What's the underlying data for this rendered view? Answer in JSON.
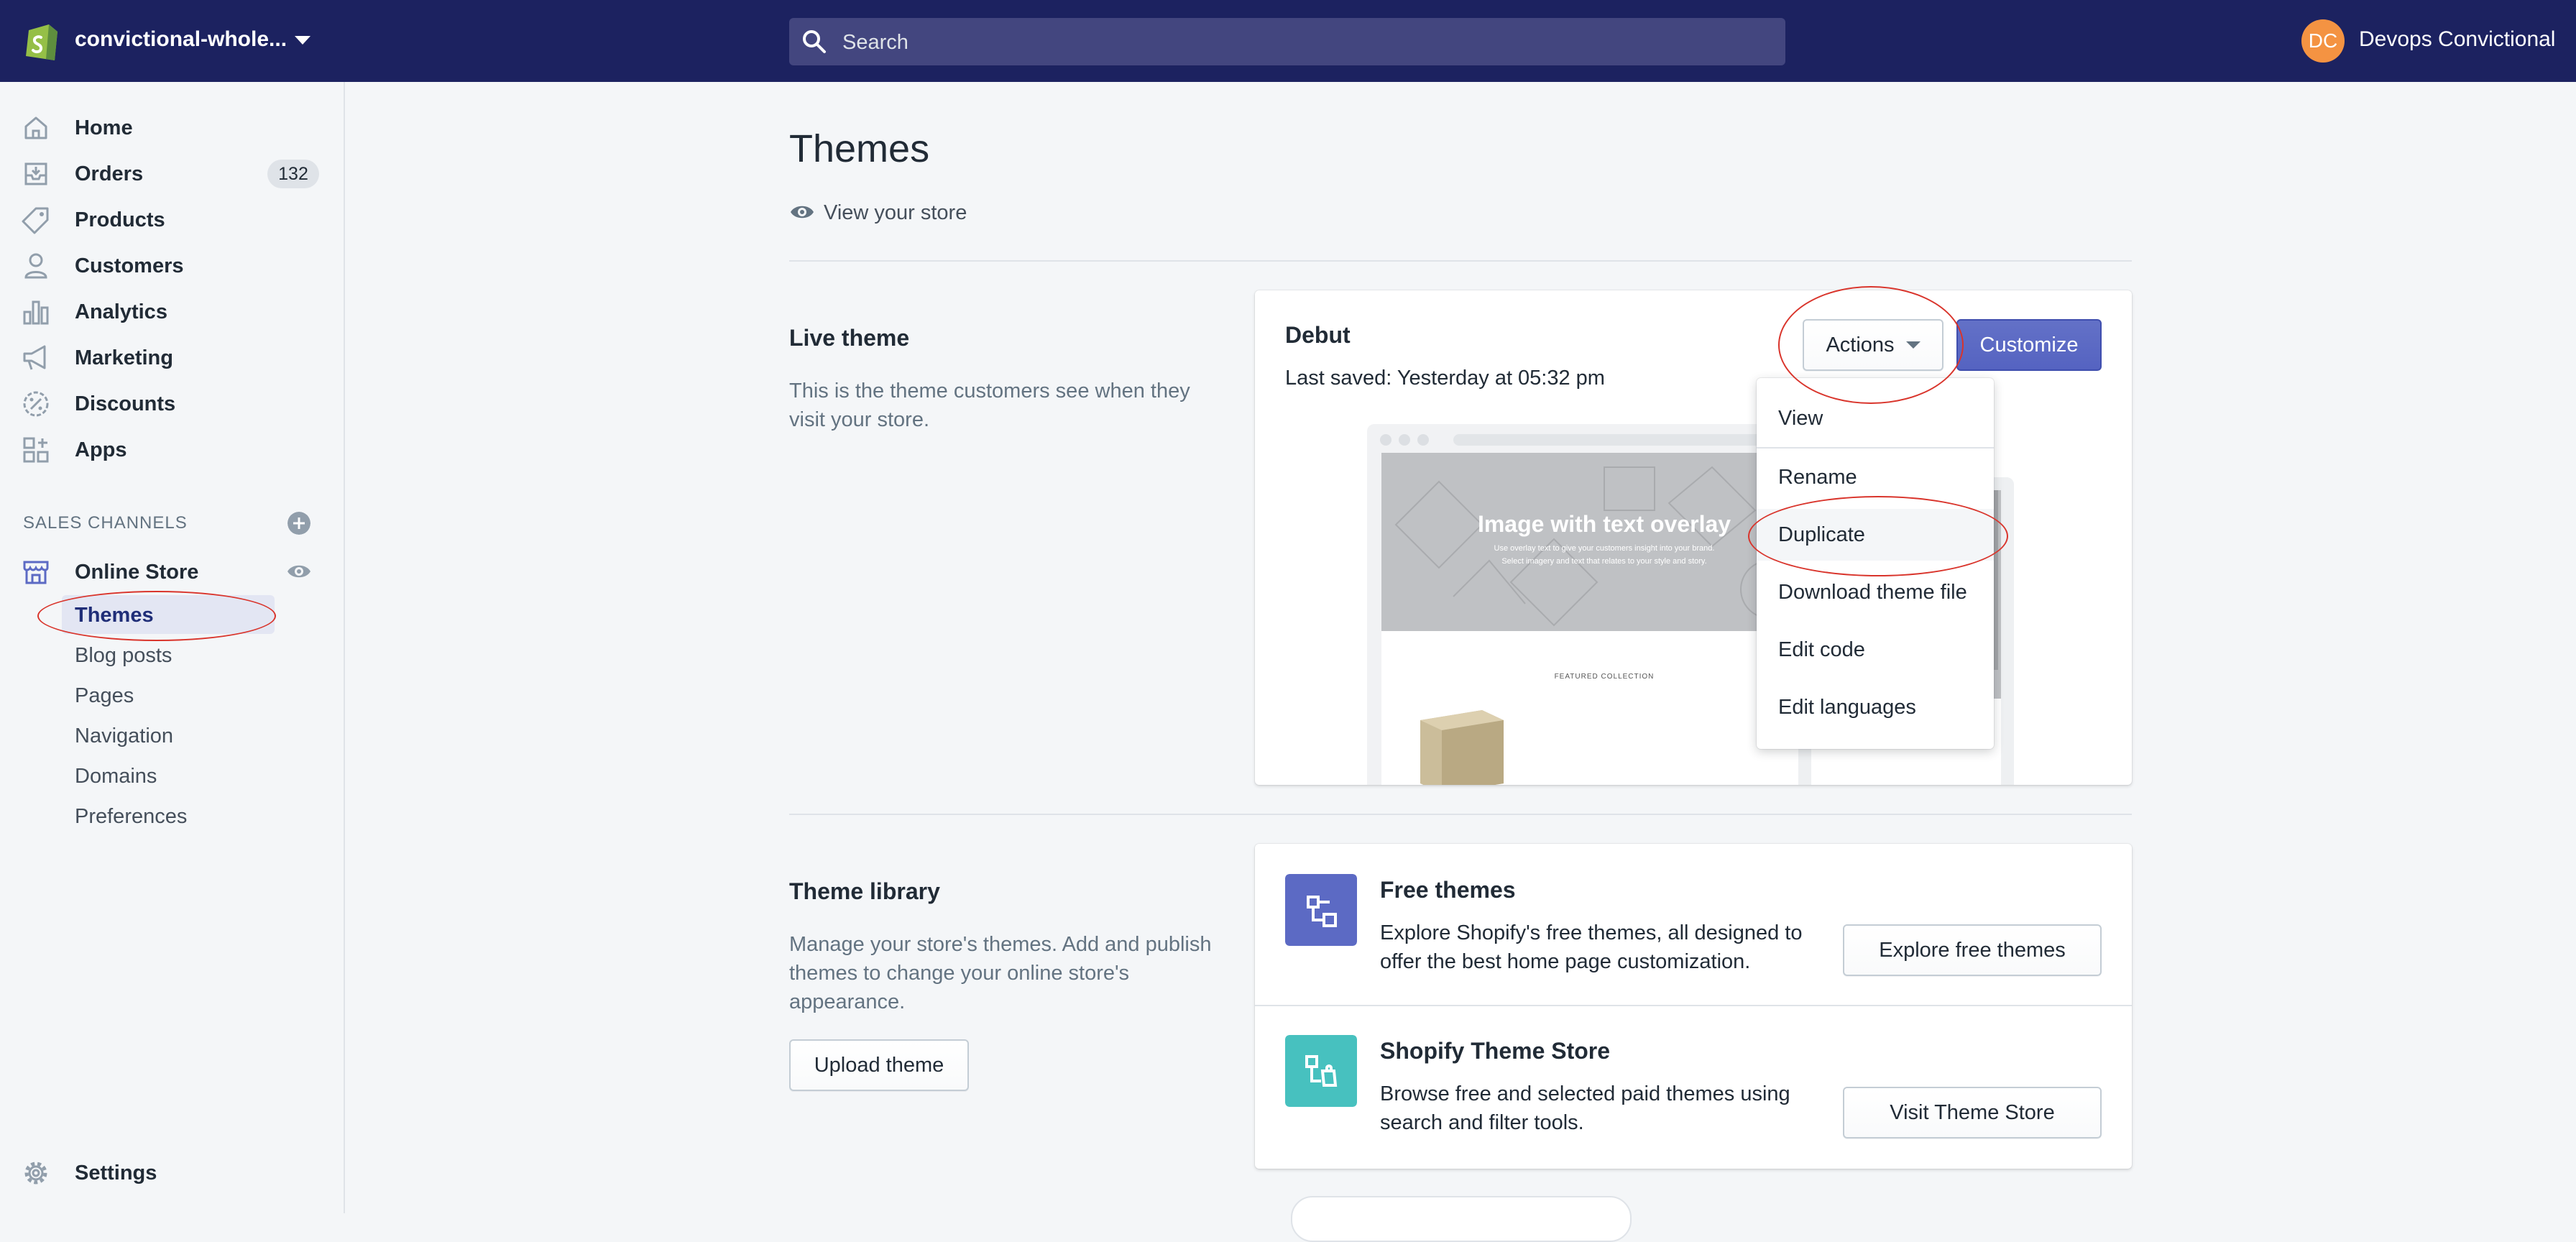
{
  "topbar": {
    "store_name": "convictional-whole...",
    "search_placeholder": "Search",
    "user_initials": "DC",
    "user_name": "Devops Convictional"
  },
  "sidebar": {
    "items": [
      {
        "label": "Home",
        "icon": "home-icon"
      },
      {
        "label": "Orders",
        "icon": "orders-icon",
        "badge": "132"
      },
      {
        "label": "Products",
        "icon": "tag-icon"
      },
      {
        "label": "Customers",
        "icon": "person-icon"
      },
      {
        "label": "Analytics",
        "icon": "bar-chart-icon"
      },
      {
        "label": "Marketing",
        "icon": "megaphone-icon"
      },
      {
        "label": "Discounts",
        "icon": "discount-icon"
      },
      {
        "label": "Apps",
        "icon": "apps-icon"
      }
    ],
    "sales_channels_label": "SALES CHANNELS",
    "online_store_label": "Online Store",
    "sub_items": [
      "Themes",
      "Blog posts",
      "Pages",
      "Navigation",
      "Domains",
      "Preferences"
    ],
    "settings_label": "Settings"
  },
  "main": {
    "title": "Themes",
    "view_store": "View your store",
    "live_theme": {
      "title": "Live theme",
      "description": "This is the theme customers see when they visit your store.",
      "theme_name": "Debut",
      "last_saved": "Last saved: Yesterday at 05:32 pm",
      "actions_label": "Actions",
      "customize_label": "Customize",
      "preview": {
        "hero_title": "Image with text overlay",
        "hero_sub1": "Use overlay text to give your customers insight into your brand.",
        "hero_sub2": "Select imagery and text that relates to your style and story.",
        "featured": "FEATURED COLLECTION"
      }
    },
    "actions_menu": [
      "View",
      "Rename",
      "Duplicate",
      "Download theme file",
      "Edit code",
      "Edit languages"
    ],
    "theme_library": {
      "title": "Theme library",
      "description": "Manage your store's themes. Add and publish themes to change your online store's appearance.",
      "upload_label": "Upload theme",
      "free": {
        "title": "Free themes",
        "description": "Explore Shopify's free themes, all designed to offer the best home page customization.",
        "button": "Explore free themes"
      },
      "store": {
        "title": "Shopify Theme Store",
        "description": "Browse free and selected paid themes using search and filter tools.",
        "button": "Visit Theme Store"
      }
    }
  },
  "colors": {
    "topbar": "#1c2260",
    "primary": "#5c6ac4",
    "teal": "#47c1bf",
    "annotation": "#d9342b"
  }
}
